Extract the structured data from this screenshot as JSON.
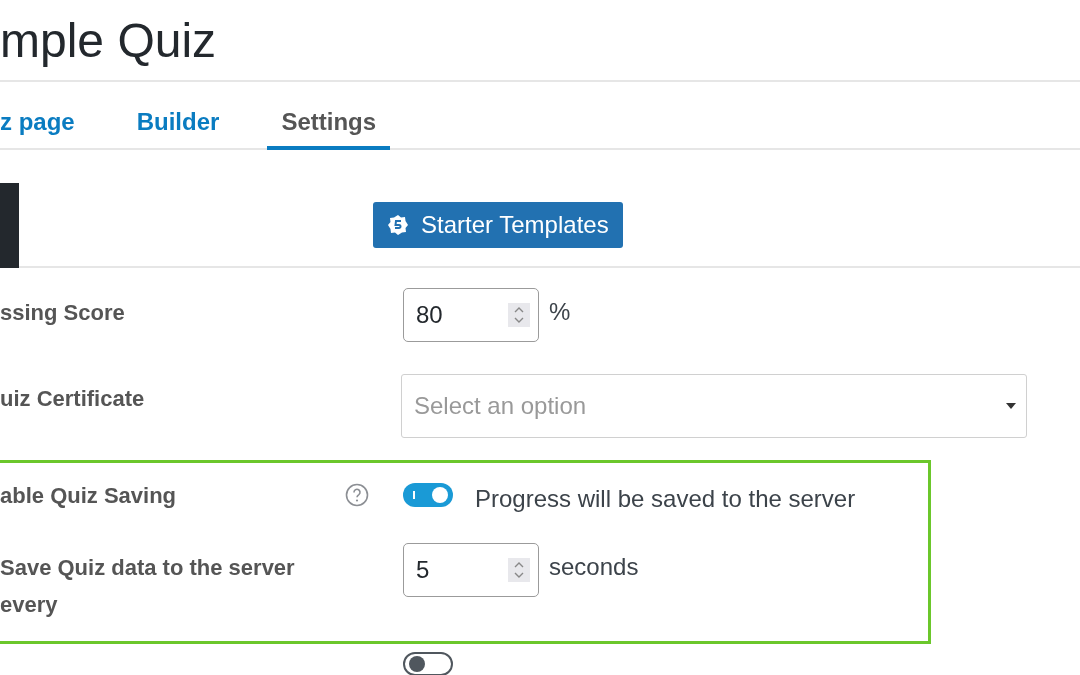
{
  "page_title": "mple Quiz",
  "tabs": [
    {
      "label": "z page",
      "selected": false
    },
    {
      "label": "Builder",
      "selected": false
    },
    {
      "label": "Settings",
      "selected": true
    }
  ],
  "toolbar": {
    "button": "Starter Templates"
  },
  "sections": [
    {
      "highlighted": false,
      "rows": [
        {
          "kind": "number",
          "label": "ssing Score",
          "help": false,
          "value": "80",
          "unit": "%"
        },
        {
          "kind": "select",
          "label": "uiz Certificate",
          "help": false,
          "placeholder": "Select an option"
        }
      ]
    },
    {
      "highlighted": true,
      "rows": [
        {
          "kind": "toggle",
          "label": "able Quiz Saving",
          "help": true,
          "on": true,
          "description": "Progress will be saved to the server"
        },
        {
          "kind": "number",
          "label": "Save Quiz data to the server every",
          "help": false,
          "value": "5",
          "unit": "seconds"
        }
      ]
    },
    {
      "highlighted": false,
      "rows": [
        {
          "kind": "toggle",
          "help": false,
          "on": false
        }
      ]
    }
  ]
}
